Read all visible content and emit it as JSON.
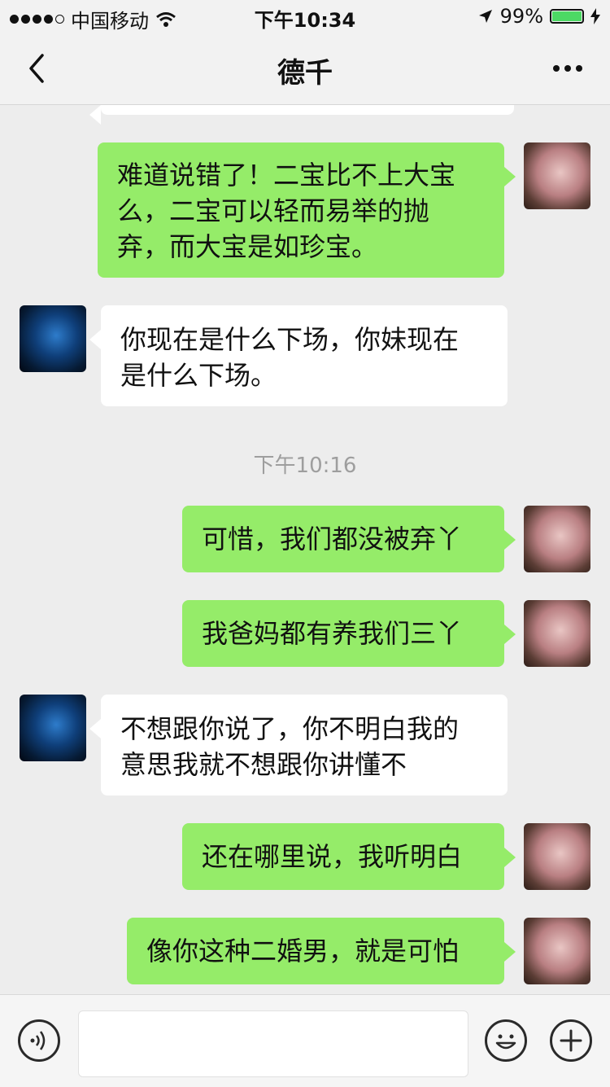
{
  "status_bar": {
    "carrier": "中国移动",
    "time": "下午10:34",
    "battery_percent": "99%",
    "battery_level": 0.99
  },
  "nav": {
    "title": "德千"
  },
  "messages": [
    {
      "sender": "me",
      "text": "难道说错了！二宝比不上大宝么，二宝可以轻而易举的抛弃，而大宝是如珍宝。",
      "lines": [
        "难道说错了！二宝比不上大宝",
        "么，二宝可以轻而易举的抛",
        "弃，而大宝是如珍宝。"
      ]
    },
    {
      "sender": "them",
      "text": "你现在是什么下场，你妹现在是什么下场。",
      "lines": [
        "你现在是什么下场，你妹现在",
        "是什么下场。"
      ]
    },
    {
      "type": "timestamp",
      "text": "下午10:16"
    },
    {
      "sender": "me",
      "text": "可惜，我们都没被弃丫"
    },
    {
      "sender": "me",
      "text": "我爸妈都有养我们三丫"
    },
    {
      "sender": "them",
      "text": "不想跟你说了，你不明白我的意思我就不想跟你讲懂不",
      "lines": [
        "不想跟你说了，你不明白我的",
        "意思我就不想跟你讲懂不"
      ]
    },
    {
      "sender": "me",
      "text": "还在哪里说，我听明白"
    },
    {
      "sender": "me",
      "text": "像你这种二婚男，就是可怕"
    }
  ],
  "icons": {
    "back": "chevron-left-icon",
    "more": "more-dots-icon",
    "voice": "voice-icon",
    "emoji": "emoji-icon",
    "plus": "plus-icon",
    "wifi": "wifi-icon",
    "location": "location-arrow-icon",
    "charging": "charging-bolt-icon"
  },
  "colors": {
    "my_bubble": "#95ec69",
    "their_bubble": "#ffffff",
    "chat_background": "#ededed",
    "battery": "#4cd964"
  }
}
